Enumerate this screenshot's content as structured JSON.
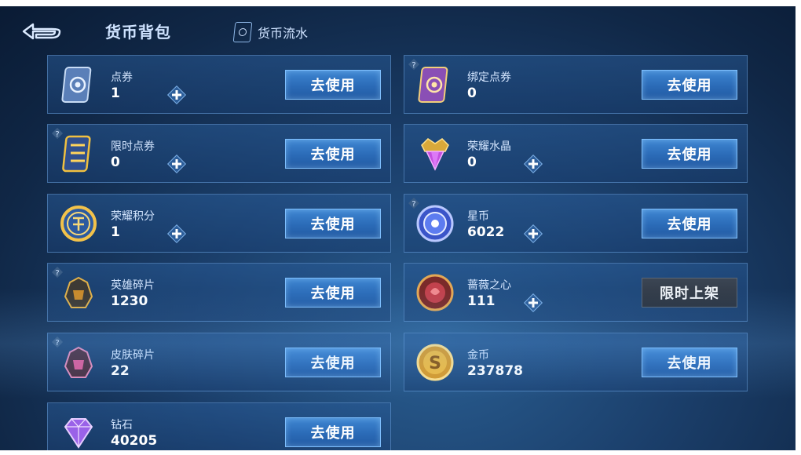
{
  "header": {
    "title": "货币背包",
    "flow_link": "货币流水"
  },
  "currencies": [
    {
      "name": "点券",
      "amount": "1",
      "action": "去使用"
    },
    {
      "name": "绑定点券",
      "amount": "0",
      "action": "去使用"
    },
    {
      "name": "限时点券",
      "amount": "0",
      "action": "去使用"
    },
    {
      "name": "荣耀水晶",
      "amount": "0",
      "action": "去使用"
    },
    {
      "name": "荣耀积分",
      "amount": "1",
      "action": "去使用"
    },
    {
      "name": "星币",
      "amount": "6022",
      "action": "去使用"
    },
    {
      "name": "英雄碎片",
      "amount": "1230",
      "action": "去使用"
    },
    {
      "name": "蔷薇之心",
      "amount": "111",
      "action": "限时上架"
    },
    {
      "name": "皮肤碎片",
      "amount": "22",
      "action": "去使用"
    },
    {
      "name": "金币",
      "amount": "237878",
      "action": "去使用"
    },
    {
      "name": "钻石",
      "amount": "40205",
      "action": "去使用"
    }
  ],
  "icons": {
    "back": "back-arrow-icon",
    "flow": "ticket-icon",
    "plus": "plus-icon",
    "help": "question-mark-icon"
  },
  "colors": {
    "background": "#1b3f6b",
    "button": "#2b6bb7",
    "button_border": "#7fc0ff",
    "limited_button": "#2a323e",
    "text": "#d4e6ff"
  }
}
